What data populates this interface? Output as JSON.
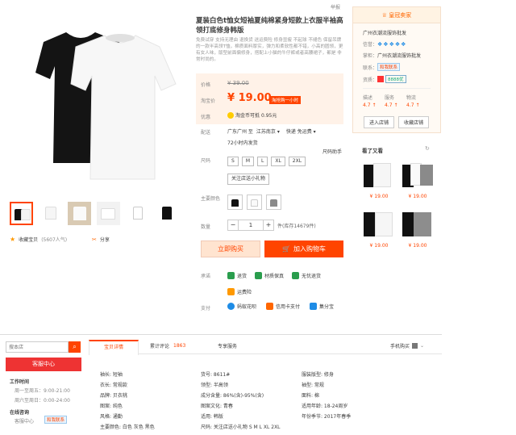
{
  "top_right_hint": "举报",
  "product": {
    "title": "夏装白色t恤女短袖夏纯棉紧身短款上衣服半袖高领打底修身韩版",
    "subtitle": "免费试穿 支持无理由 退换货 送运费险 修身显瘦 不起球 不褪色 保留吊牌的一款半高领T恤，棉质面料厚实，弹力和柔软性都不错，小高的圆领，更有女人味，版型前面偏修身，搭配上小猫的牛仔裤或者高腰裙子，都是 非常时尚的。",
    "price_label": "价格",
    "price_old": "¥ 39.00",
    "promo_label": "淘宝价",
    "promo_price": "¥ 19.00",
    "promo_badge": "淘抢购一小时",
    "youhui_label": "优惠",
    "coin_text": "淘金币可抵",
    "coin_amount": "0.95元",
    "ship_label": "配送",
    "ship_from": "广东广州 至",
    "ship_to": "江苏南京 ▾",
    "ship_method": "快递 免运费 ▾",
    "ship_time": "72小时内发货",
    "size_label": "尺码",
    "size_help": "尺码助手",
    "sizes": [
      "S",
      "M",
      "L",
      "XL",
      "2XL"
    ],
    "gift": "关注店送小礼物",
    "color_label": "主要颜色",
    "qty_label": "数量",
    "qty_minus": "−",
    "qty_value": "1",
    "qty_plus": "+",
    "stock": "件(库存14679件)",
    "buy_now": "立即购买",
    "add_cart": "加入购物车",
    "promise_label": "承诺",
    "promises": [
      "退货",
      "材质保真",
      "无忧退货",
      "运费险"
    ],
    "pay_label": "支付",
    "pays": [
      "蚂蚁花呗",
      "信用卡支付",
      "集分宝"
    ],
    "fav": "收藏宝贝",
    "fav_count": "(5607人气)",
    "share": "分享"
  },
  "shop": {
    "header": "皇冠卖家",
    "name": "广州衣潮流服饰批发",
    "credit_label": "信誉：",
    "seller_label": "掌柜：",
    "seller_name": "广州衣潮流服饰批发",
    "contact_label": "联系：",
    "contact_badge": "和我联系",
    "qual_label": "资质：",
    "qual_badge": "8888优",
    "ratings": [
      {
        "label": "描述",
        "value": "4.7 ↑"
      },
      {
        "label": "服务",
        "value": "4.7 ↑"
      },
      {
        "label": "物流",
        "value": "4.7 ↑"
      }
    ],
    "enter": "进入店铺",
    "collect": "收藏店铺",
    "see_also": "看了又看",
    "see_prices": [
      "¥ 19.00",
      "¥ 19.00",
      "¥ 19.00",
      "¥ 19.00"
    ]
  },
  "bottom": {
    "search_placeholder": "搜本店",
    "service_header": "客服中心",
    "work_time": "工作时间",
    "weekday": "周一至周五：9:00-21:00",
    "weekend": "周六至周日：0:00-24:00",
    "online": "在线咨询",
    "online_name": "客服中心",
    "online_badge": "和我联系",
    "tabs": [
      {
        "label": "宝贝详情"
      },
      {
        "label": "累计评论",
        "count": "1863"
      },
      {
        "label": "专享服务"
      }
    ],
    "mobile_buy": "手机购买",
    "attrs_col1": [
      "袖长: 短袖",
      "衣长: 常规款",
      "品牌: 贝衣桃",
      "图案: 纯色",
      "风格: 通勤",
      "主要颜色: 白色 灰色 黑色"
    ],
    "attrs_col2": [
      "货号: 8611#",
      "领型: 半高领",
      "成分含量: 86%(含)-95%(含)",
      "图案文化: 青春",
      "适用: 韩版",
      "尺码: 关注店送小礼物 S M L XL 2XL"
    ],
    "attrs_col3": [
      "服装版型: 修身",
      "袖型: 常规",
      "面料: 棉",
      "适用年龄: 18-24周岁",
      "年份季节: 2017年春季"
    ]
  },
  "colors": {
    "accent": "#ff4400",
    "promo_bg": "#fff2e8",
    "buy_bg": "#ffeded"
  }
}
